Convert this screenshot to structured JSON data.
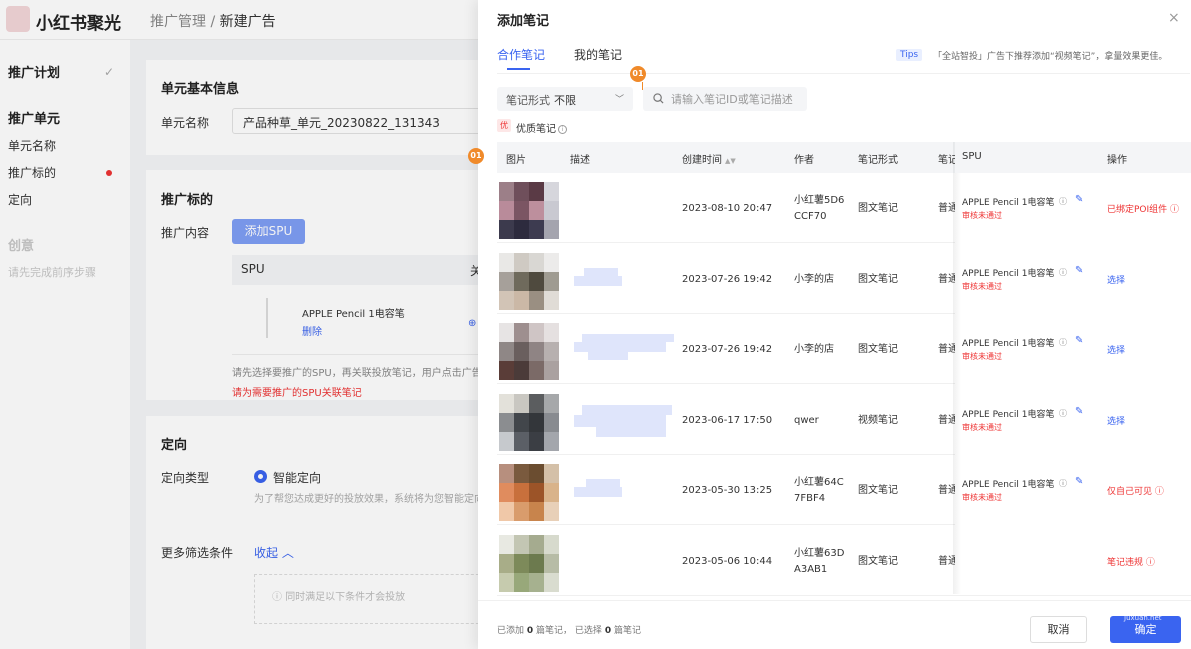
{
  "app": {
    "logo_text": "小红书聚光"
  },
  "breadcrumb": {
    "parent": "推广管理",
    "separator": " / ",
    "current": "新建广告"
  },
  "leftnav": {
    "plan": "推广计划",
    "unit": "推广单元",
    "unit_name": "单元名称",
    "target": "推广标的",
    "targeting": "定向",
    "creative": "创意",
    "creative_hint": "请先完成前序步骤"
  },
  "unit_card": {
    "title": "单元基本信息",
    "name_label": "单元名称",
    "name_value": "产品种草_单元_20230822_131343"
  },
  "target_card": {
    "title": "推广标的",
    "content_label": "推广内容",
    "add_spu": "添加SPU",
    "spu_header": "SPU",
    "spu_header_trunc": "关",
    "spu_name": "APPLE Pencil 1电容笔",
    "spu_delete": "删除",
    "hint": "请先选择要推广的SPU，再关联投放笔记，用户点击广告将",
    "error": "请为需要推广的SPU关联笔记"
  },
  "targeting_card": {
    "title": "定向",
    "type_label": "定向类型",
    "smart": "智能定向",
    "smart_hint": "为了帮您达成更好的投放效果，系统将为您智能定向",
    "more_label": "更多筛选条件",
    "collapse": "收起",
    "filter_hint": "同时满足以下条件才会投放"
  },
  "drawer": {
    "title": "添加笔记",
    "close": "×",
    "tabs": [
      "合作笔记",
      "我的笔记"
    ],
    "tips_badge": "Tips",
    "tips_text": "「全站智投」广告下推荐添加“视频笔记”，拿量效果更佳。",
    "filter_label": "笔记形式",
    "filter_value": "不限",
    "search_placeholder": "请输入笔记ID或笔记描述",
    "annotation": "01",
    "quality_badge": "优",
    "quality_label": "优质笔记",
    "columns": {
      "image": "图片",
      "desc": "描述",
      "created": "创建时间",
      "author": "作者",
      "format": "笔记形式",
      "type_trunc": "笔记",
      "spu": "SPU",
      "action": "操作"
    },
    "rows": [
      {
        "created": "2023-08-10 20:47",
        "author": [
          "小红薯5D6",
          "CCF70"
        ],
        "format": "图文笔记",
        "type": "普通",
        "spu": "APPLE Pencil 1电容笔",
        "status": "审核未通过",
        "action": "已绑定POI组件",
        "action_type": "red",
        "thumb": [
          "#9c7f88",
          "#6f4f5b",
          "#5a3a45",
          "#d6d6dc",
          "#b98b9a",
          "#7b5563",
          "#bd8f9d",
          "#c9c9d1",
          "#3c3a4d",
          "#2d2b3e",
          "#3d3b50",
          "#a4a4ae"
        ],
        "desc": false
      },
      {
        "created": "2023-07-26 19:42",
        "author": [
          "小李的店"
        ],
        "format": "图文笔记",
        "type": "普通",
        "spu": "APPLE Pencil 1电容笔",
        "status": "审核未通过",
        "action": "选择",
        "action_type": "blue",
        "thumb": [
          "#e9e8e6",
          "#cfcac3",
          "#d9d7d3",
          "#ecebea",
          "#a6a09a",
          "#6f6a5c",
          "#4f4a3e",
          "#9f9b91",
          "#d2c4b6",
          "#cbb8a6",
          "#9a8f82",
          "#e0dcd6"
        ],
        "desc": true
      },
      {
        "created": "2023-07-26 19:42",
        "author": [
          "小李的店"
        ],
        "format": "图文笔记",
        "type": "普通",
        "spu": "APPLE Pencil 1电容笔",
        "status": "审核未通过",
        "action": "选择",
        "action_type": "blue",
        "thumb": [
          "#e7e4e4",
          "#9e8f8f",
          "#cfc5c5",
          "#e5e0e0",
          "#8f8786",
          "#6a5f5e",
          "#8f8484",
          "#b7b0af",
          "#5a3d38",
          "#4b3b39",
          "#7b6a67",
          "#aaa1a0"
        ],
        "desc": true
      },
      {
        "created": "2023-06-17 17:50",
        "author": [
          "qwer"
        ],
        "format": "视频笔记",
        "type": "普通",
        "spu": "APPLE Pencil 1电容笔",
        "status": "审核未通过",
        "action": "选择",
        "action_type": "blue",
        "thumb": [
          "#e3e1da",
          "#c9c7c1",
          "#5b5d5f",
          "#a6a8aa",
          "#8b8d90",
          "#42464b",
          "#33363a",
          "#888b90",
          "#c6c9cd",
          "#5b5f66",
          "#3b3e44",
          "#a3a6ac"
        ],
        "desc": true
      },
      {
        "created": "2023-05-30 13:25",
        "author": [
          "小红薯64C",
          "7FBF4"
        ],
        "format": "图文笔记",
        "type": "普通",
        "spu": "APPLE Pencil 1电容笔",
        "status": "审核未通过",
        "action": "仅自己可见",
        "action_type": "red",
        "thumb": [
          "#b78f7e",
          "#7a5a3e",
          "#6b4d30",
          "#d4c0a8",
          "#e08c5e",
          "#c8703c",
          "#9c5428",
          "#d9b38a",
          "#f0c8a8",
          "#d99c6c",
          "#c8844c",
          "#e8d0b8"
        ],
        "desc": true
      },
      {
        "created": "2023-05-06 10:44",
        "author": [
          "小红薯63D",
          "A3AB1"
        ],
        "format": "图文笔记",
        "type": "普通",
        "spu": "",
        "status": "",
        "action": "笔记违规",
        "action_type": "red",
        "thumb": [
          "#e8e9e2",
          "#c3c6b3",
          "#a5ab8f",
          "#d7dacd",
          "#a8ad88",
          "#7d8a5a",
          "#6c7a4e",
          "#b7bca6",
          "#c6cbae",
          "#98a87a",
          "#a6b18f",
          "#d9dccf"
        ],
        "desc": false
      }
    ],
    "footer": {
      "added_prefix": "已添加",
      "added_count": "0",
      "added_suffix": "篇笔记，",
      "selected_prefix": "已选择",
      "selected_count": "0",
      "selected_suffix": "篇笔记"
    },
    "cancel": "取消",
    "confirm": "确定",
    "watermark": "Juxuan.net"
  }
}
